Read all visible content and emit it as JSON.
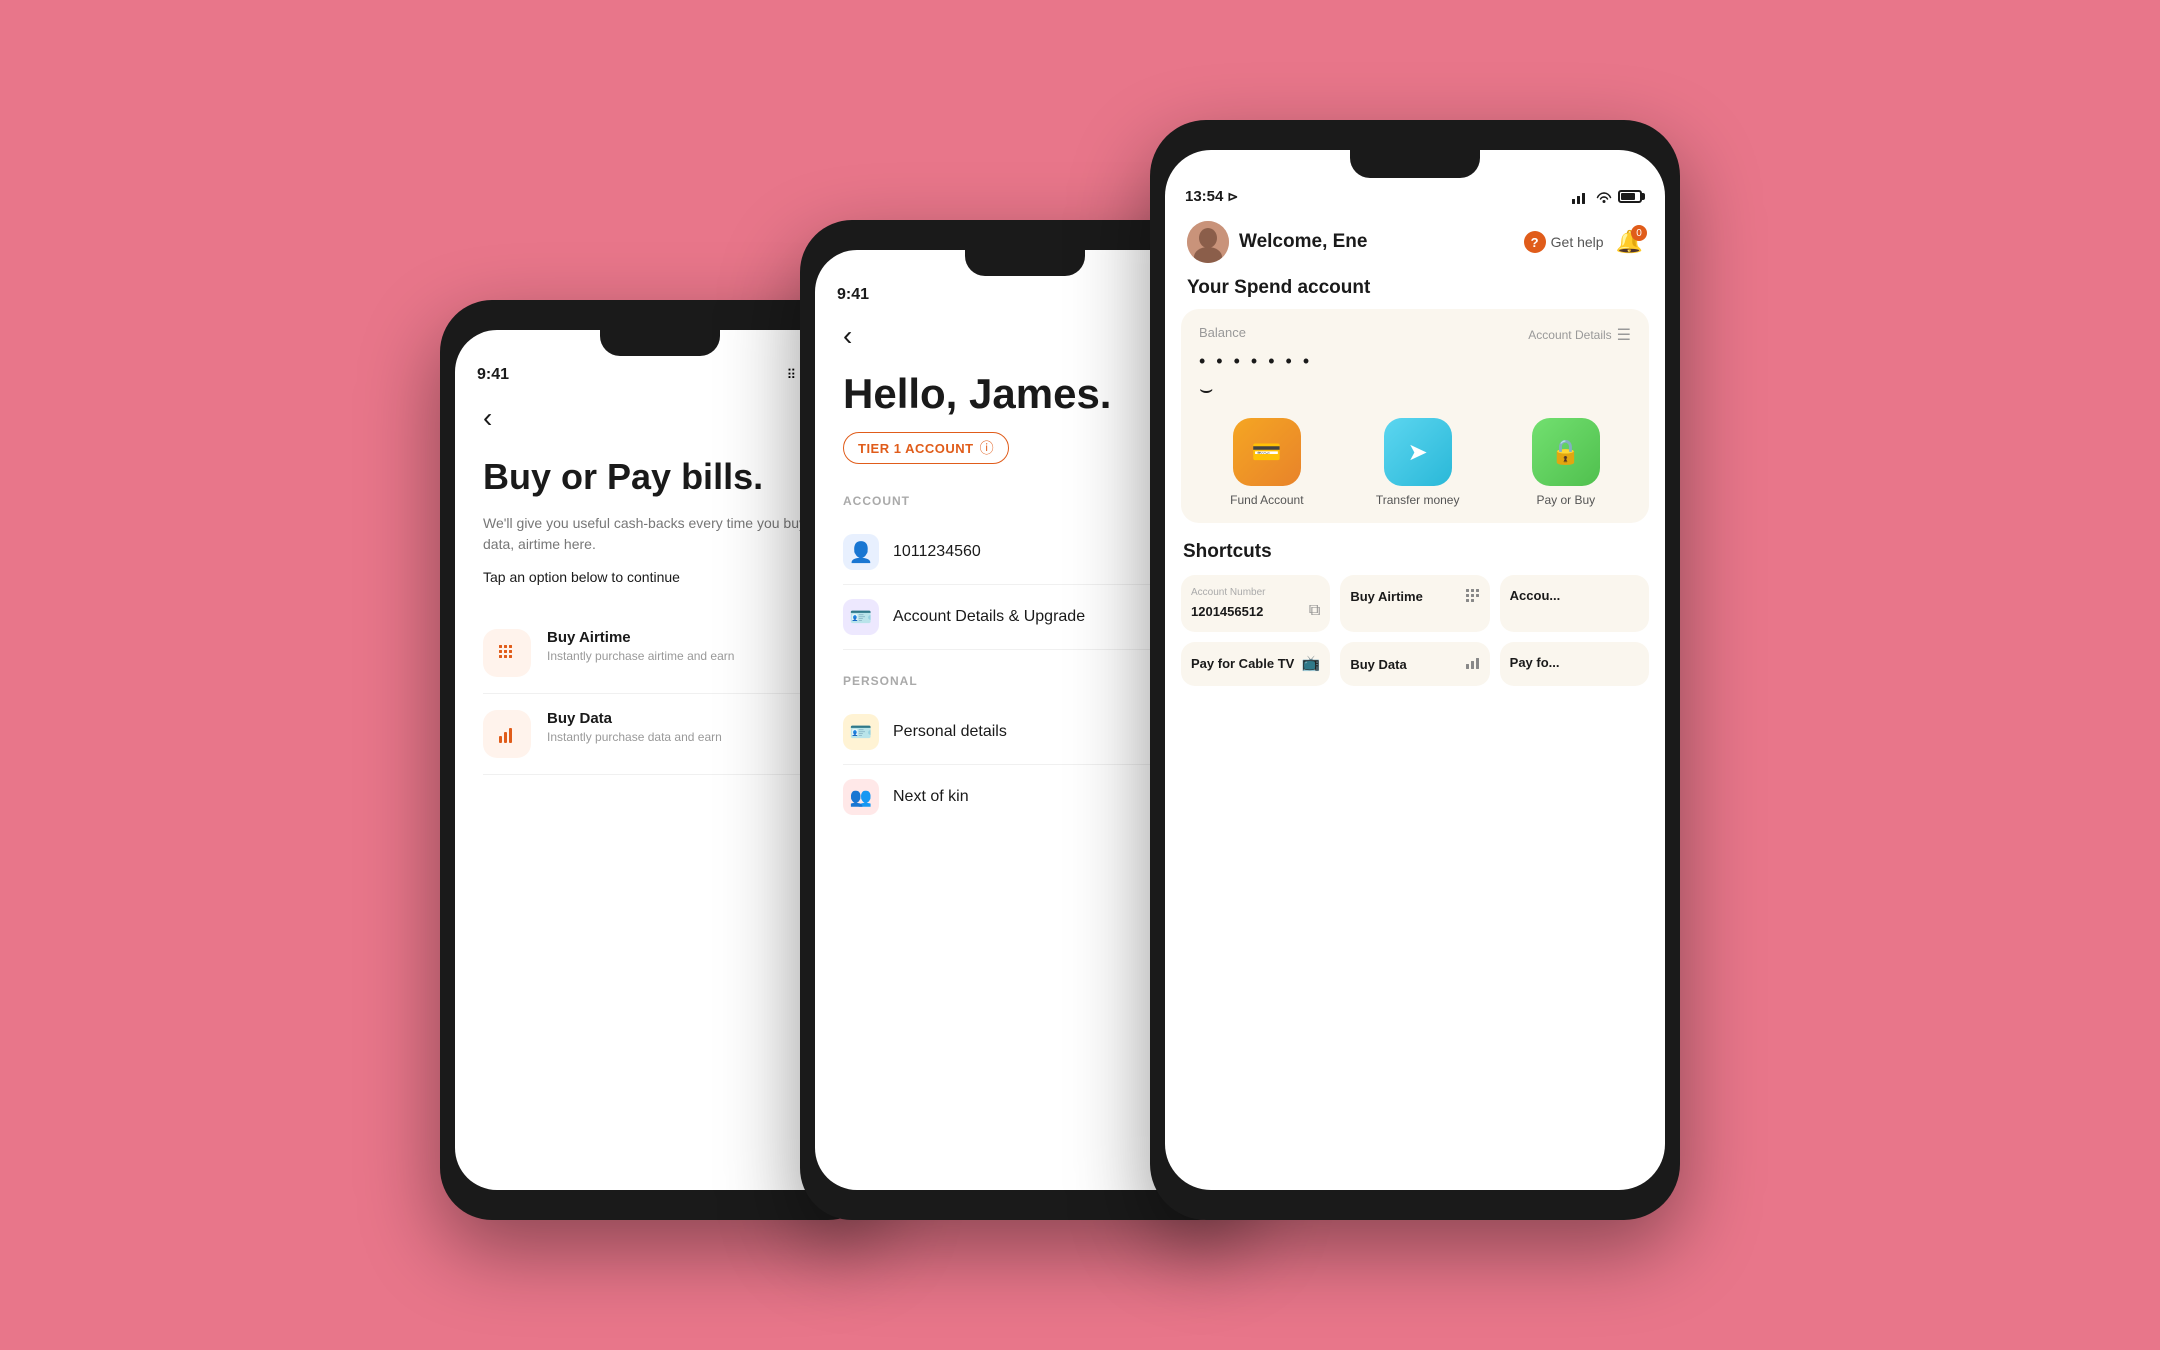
{
  "background_color": "#e8768a",
  "phone1": {
    "status_time": "9:41",
    "back_label": "‹",
    "title": "Buy or Pay bills.",
    "subtitle": "We'll give you useful cash-backs every time you buy data, airtime here.",
    "tap_label": "Tap an option below to continue",
    "menu_items": [
      {
        "id": "airtime",
        "title": "Buy Airtime",
        "description": "Instantly purchase airtime and earn",
        "icon": "⠿",
        "icon_color": "#e05c1a"
      },
      {
        "id": "data",
        "title": "Buy Data",
        "description": "Instantly purchase data and earn",
        "icon": "📶",
        "icon_color": "#e05c1a"
      }
    ]
  },
  "phone2": {
    "status_time": "9:41",
    "back_label": "‹",
    "greeting": "Hello, James.",
    "tier_label": "TIER 1 ACCOUNT",
    "account_section": "ACCOUNT",
    "account_number": "1011234560",
    "account_details_label": "Account Details & Upgrade",
    "personal_section": "PERSONAL",
    "personal_details_label": "Personal details",
    "next_of_kin_label": "Next of kin"
  },
  "phone3": {
    "status_time": "13:54",
    "welcome_text": "Welcome, Ene",
    "get_help_label": "Get help",
    "notification_count": "0",
    "spend_account_title": "Your Spend account",
    "balance_label": "Balance",
    "account_details_label": "Account Details",
    "balance_dots": "• • • • • • •",
    "balance_symbol": "⌣",
    "action_buttons": [
      {
        "id": "fund",
        "label": "Fund Account",
        "icon": "💳",
        "color_class": "action-fund"
      },
      {
        "id": "transfer",
        "label": "Transfer money",
        "icon": "➤",
        "color_class": "action-transfer"
      },
      {
        "id": "pay",
        "label": "Pay or Buy",
        "icon": "🔒",
        "color_class": "action-pay"
      }
    ],
    "shortcuts_title": "Shortcuts",
    "shortcuts": [
      {
        "id": "account-number",
        "label": "Account Number",
        "value": "1201456512",
        "icon": "⧉"
      },
      {
        "id": "buy-airtime",
        "label": "",
        "value": "Buy Airtime",
        "icon": "⠿"
      },
      {
        "id": "account",
        "label": "",
        "value": "Accou...",
        "icon": ""
      },
      {
        "id": "cable-tv",
        "label": "",
        "value": "Pay for Cable TV",
        "icon": "📺"
      },
      {
        "id": "buy-data",
        "label": "",
        "value": "Buy Data",
        "icon": "📶"
      },
      {
        "id": "pay-for",
        "label": "",
        "value": "Pay fo...",
        "icon": ""
      }
    ]
  }
}
